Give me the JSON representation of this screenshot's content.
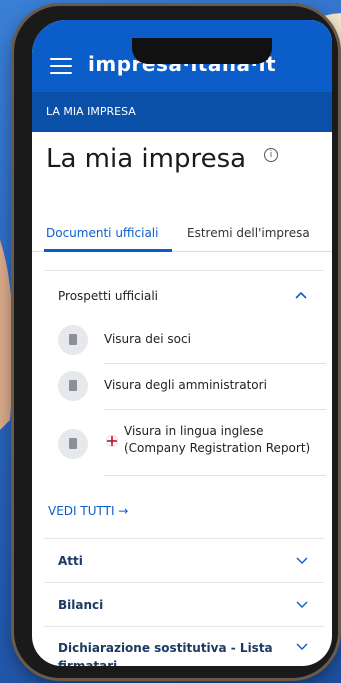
{
  "app": {
    "brand": "impresa·italia·it",
    "section": "LA MIA IMPRESA"
  },
  "page": {
    "title": "La mia impresa",
    "info_glyph": "i"
  },
  "tabs": [
    {
      "label": "Documenti ufficiali",
      "active": true
    },
    {
      "label": "Estremi dell'impresa",
      "active": false
    }
  ],
  "prospetti": {
    "heading": "Prospetti ufficiali",
    "items": [
      {
        "label": "Visura dei soci"
      },
      {
        "label": "Visura degli amministratori"
      },
      {
        "label_line1": "Visura in lingua inglese",
        "label_line2": "(Company Registration Report)"
      }
    ]
  },
  "links": {
    "vedi_tutti": "VEDI TUTTI →"
  },
  "accordion": [
    {
      "label": "Atti"
    },
    {
      "label": "Bilanci"
    },
    {
      "label_line1": "Dichiarazione sostitutiva - Lista",
      "label_line2": "firmatari"
    }
  ],
  "colors": {
    "brand_blue": "#0b5ec9",
    "subbar_blue": "#0a4fa8",
    "accordion_text": "#1c3a63"
  }
}
